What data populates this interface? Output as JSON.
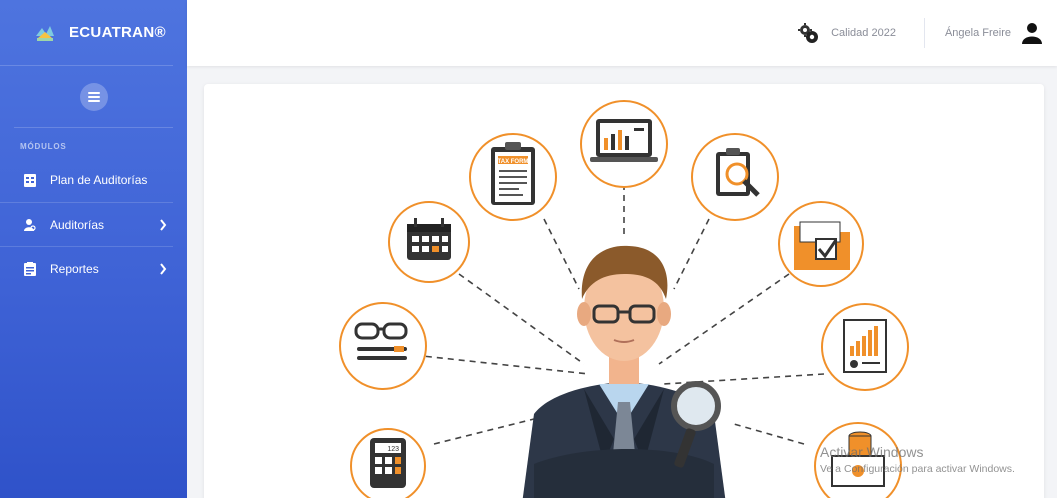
{
  "brand": {
    "name": "ECUATRAN®"
  },
  "sidebar": {
    "section_label": "MÓDULOS",
    "items": [
      {
        "label": "Plan de Auditorías",
        "has_submenu": false
      },
      {
        "label": "Auditorías",
        "has_submenu": true
      },
      {
        "label": "Reportes",
        "has_submenu": true
      }
    ]
  },
  "topbar": {
    "quality_label": "Calidad 2022",
    "user_name": "Ángela Freire"
  },
  "watermark": {
    "title": "Activar Windows",
    "subtitle": "Ve a Configuración para activar Windows."
  },
  "illustration": {
    "form_label": "TAX FORM",
    "calculator_display": "123"
  },
  "colors": {
    "sidebar_top": "#4e74df",
    "sidebar_bottom": "#2f52c9",
    "accent_orange": "#f0902a"
  }
}
